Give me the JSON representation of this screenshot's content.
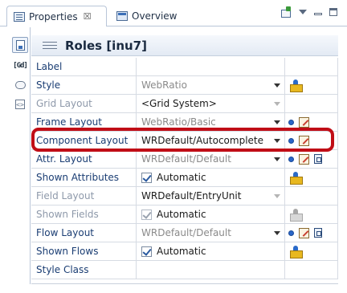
{
  "tabs": [
    {
      "label": "Properties",
      "close": "☒",
      "active": true
    },
    {
      "label": "Overview",
      "active": false
    }
  ],
  "header": {
    "title": "Roles [inu7]"
  },
  "rows": [
    {
      "label": "Label",
      "value": "",
      "active": true
    },
    {
      "label": "Style",
      "value": "WebRatio",
      "active": true
    },
    {
      "label": "Grid Layout",
      "value": "<Grid System>",
      "active": false
    },
    {
      "label": "Frame Layout",
      "value": "WebRatio/Basic",
      "active": false
    },
    {
      "label": "Component Layout",
      "value": "WRDefault/Autocomplete",
      "active": true
    },
    {
      "label": "Attr. Layout",
      "value": "WRDefault/Default",
      "active": true
    },
    {
      "label": "Shown Attributes",
      "value": "Automatic",
      "active": true
    },
    {
      "label": "Field Layout",
      "value": "WRDefault/EntryUnit",
      "active": false
    },
    {
      "label": "Shown Fields",
      "value": "Automatic",
      "active": false
    },
    {
      "label": "Flow Layout",
      "value": "WRDefault/Default",
      "active": true
    },
    {
      "label": "Shown Flows",
      "value": "Automatic",
      "active": true
    },
    {
      "label": "Style Class",
      "value": "",
      "active": true
    }
  ],
  "colors": {
    "highlight": "#c00d16",
    "label": "#1a3d73"
  }
}
